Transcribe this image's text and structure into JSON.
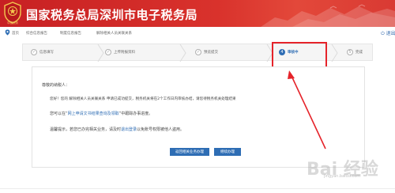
{
  "header": {
    "title": "国家税务总局深圳市电子税务局",
    "emblem_text": "中国税务",
    "brand_color": "#c72023"
  },
  "nav": {
    "home": "首页",
    "items": [
      "综合信息报告",
      "制度信息报告",
      "解除相关人员关联关系"
    ],
    "logout": "退出"
  },
  "steps": [
    {
      "num": "",
      "label": "信息填写",
      "state": "done"
    },
    {
      "num": "",
      "label": "上传附报资料",
      "state": "done"
    },
    {
      "num": "",
      "label": "预览提交",
      "state": "done"
    },
    {
      "num": "4",
      "label": "审核中",
      "state": "active"
    },
    {
      "num": "5",
      "label": "完成",
      "state": "pending"
    }
  ],
  "content": {
    "greeting": "尊敬的纳税人：",
    "line1": "您好！您的 解除相关人员关联关系 申请已成功提交，税务机关将在2个工作日内审核办结，请您待税务机关处理结果",
    "line2_prefix": "您可以在“",
    "line2_link": "网上申请文书结果查询及领取",
    "line2_suffix": "”中跟踪办事进度。",
    "line3_prefix": "温馨提示，若您已办完相关业务，请及时",
    "line3_link": "退出登录",
    "line3_suffix": "以免账号权限被他人盗用。",
    "button_primary": "返回相关业务办理",
    "button_secondary": "继续办理"
  },
  "watermark": {
    "main": "Bai 经验",
    "sub": "jingyan.baidu.com"
  },
  "colors": {
    "accent": "#2e6db4",
    "highlight": "#e5232a"
  }
}
